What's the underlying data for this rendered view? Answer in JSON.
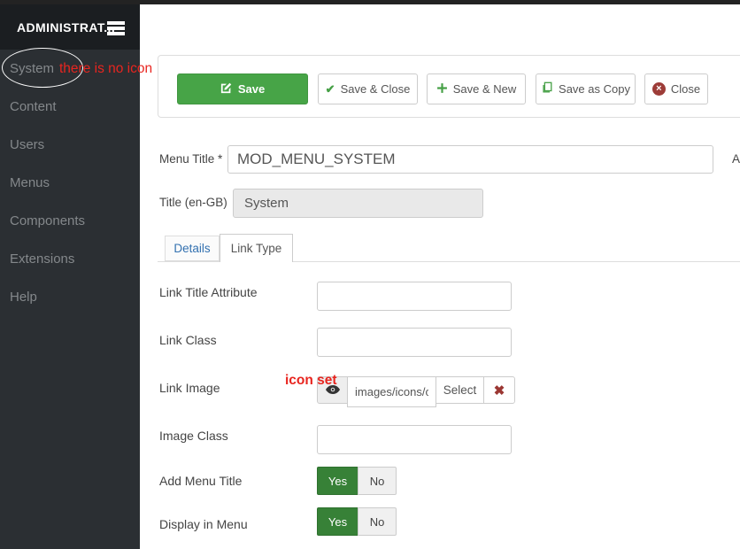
{
  "sidebar": {
    "title": "ADMINISTRAT...",
    "items": [
      {
        "label": "System"
      },
      {
        "label": "Content"
      },
      {
        "label": "Users"
      },
      {
        "label": "Menus"
      },
      {
        "label": "Components"
      },
      {
        "label": "Extensions"
      },
      {
        "label": "Help"
      }
    ]
  },
  "annotations": {
    "no_icon": "there is no icon",
    "icon_set": "icon set",
    "red_color": "#e8251f",
    "ellipse_color": "#ffffff"
  },
  "toolbar": {
    "buttons": [
      {
        "label": "Save",
        "icon": "save-icon"
      },
      {
        "label": "Save & Close",
        "icon": "check-icon"
      },
      {
        "label": "Save & New",
        "icon": "plus-icon"
      },
      {
        "label": "Save as Copy",
        "icon": "copy-icon"
      },
      {
        "label": "Close",
        "icon": "close-circle-icon"
      }
    ]
  },
  "form": {
    "menu_title": {
      "label": "Menu Title *",
      "value": "MOD_MENU_SYSTEM"
    },
    "alias_partial": "A",
    "title_translation": {
      "label": "Title (en-GB)",
      "value": "System"
    },
    "tabs": [
      {
        "label": "Details",
        "active": false
      },
      {
        "label": "Link Type",
        "active": true
      }
    ],
    "link_title_attribute": {
      "label": "Link Title Attribute",
      "value": ""
    },
    "link_class": {
      "label": "Link Class",
      "value": ""
    },
    "link_image": {
      "label": "Link Image",
      "value": "images/icons/co",
      "select_label": "Select"
    },
    "image_class": {
      "label": "Image Class",
      "value": ""
    },
    "add_menu_title": {
      "label": "Add Menu Title",
      "yes": "Yes",
      "no": "No",
      "selected": "Yes"
    },
    "display_in_menu": {
      "label": "Display in Menu",
      "yes": "Yes",
      "no": "No",
      "selected": "Yes"
    }
  },
  "colors": {
    "save_green": "#47a447",
    "toggle_green": "#378137",
    "icon_green": "#46a046",
    "close_red": "#9d3c38",
    "sidebar_bg": "#2b2f33",
    "sidebar_header_bg": "#1b1e21"
  }
}
